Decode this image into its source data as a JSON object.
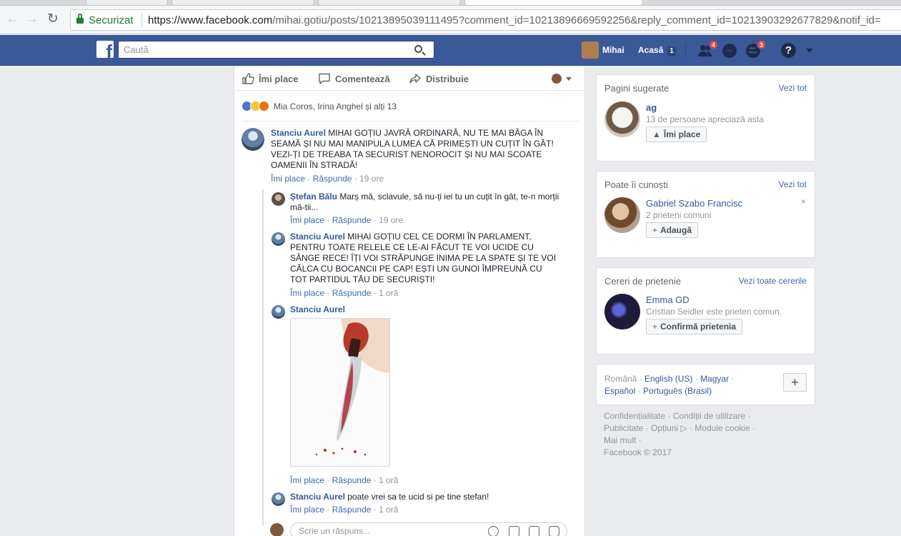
{
  "browser": {
    "secure_label": "Securizat",
    "url_domain": "https://www.facebook.com",
    "url_path": "/mihai.gotiu/posts/10213895039111495?comment_id=10213896669592256&reply_comment_id=10213903292677829&notif_id="
  },
  "topbar": {
    "search_placeholder": "Caută",
    "user_name": "Mihai",
    "home_label": "Acasă",
    "home_count": "1",
    "friend_requests_badge": "4",
    "notifications_badge": "3",
    "help_label": "?"
  },
  "post_actions": {
    "like": "Îmi place",
    "comment": "Comentează",
    "share": "Distribuie"
  },
  "reactions": {
    "summary": "Mia Coros, Irina Anghel și alți 13",
    "types": [
      "like",
      "wow",
      "angry"
    ],
    "colors": {
      "like": "#4d74d6",
      "wow": "#f5c33b",
      "angry": "#e9710f"
    }
  },
  "comments": [
    {
      "author": "Stanciu Aurel",
      "lines": [
        "MIHAI GOȚIU JAVRĂ ORDINARĂ, NU TE MAI BĂGA ÎN",
        "SEAMĂ ȘI NU MAI MANIPULA LUMEA CĂ PRIMEȘTI UN CUȚIT ÎN GÂT!",
        "VEZI-ȚI DE TREABA TA SECURIST NENOROCIT ȘI NU MAI SCOATE",
        "OAMENII ÎN STRADĂ!"
      ],
      "like": "Îmi place",
      "reply": "Răspunde",
      "time": "19 ore"
    },
    {
      "author": "Ștefan Bălu",
      "lines": [
        "Marș mă, sclavule, să nu-ți iei tu un cuțit în gât, te-n morții",
        "mă-tii..."
      ],
      "like": "Îmi place",
      "reply": "Răspunde",
      "time": "19 ore"
    },
    {
      "author": "Stanciu Aurel",
      "lines": [
        "MIHAI GOȚIU CEL CE DORMI ÎN PARLAMENT,",
        "PENTRU TOATE RELELE CE LE-AI FĂCUT TE VOI UCIDE CU",
        "SÂNGE RECE! ÎȚI VOI STRĂPUNGE INIMA PE LA SPATE ȘI TE VOI",
        "CĂLCA CU BOCANCII PE CAP! EȘTI UN GUNOI ÎMPREUNĂ CU",
        "TOT PARTIDUL TĂU DE SECURIȘTI!"
      ],
      "like": "Îmi place",
      "reply": "Răspunde",
      "time": "1 oră"
    },
    {
      "author": "Stanciu Aurel",
      "lines": [],
      "like": "Îmi place",
      "reply": "Răspunde",
      "time": "1 oră"
    },
    {
      "author": "Stanciu Aurel",
      "lines": [
        "poate vrei sa te ucid si pe tine stefan!"
      ],
      "like": "Îmi place",
      "reply": "Răspunde",
      "time": "1 oră"
    }
  ],
  "reply_placeholder": "Scrie un răspuns...",
  "sidebar": {
    "suggested_pages": {
      "title": "Pagini sugerate",
      "link": "Vezi tot",
      "name": "ag",
      "sub": "13 de persoane apreciază asta",
      "button": "Îmi place"
    },
    "people_you_may_know": {
      "title": "Poate îi cunoști",
      "link": "Vezi tot",
      "name": "Gabriel Szabo Francisc",
      "sub": "2 prieteni comuni",
      "button": "Adaugă",
      "close": "×"
    },
    "friend_requests": {
      "title": "Cereri de prietenie",
      "link": "Vezi toate cererile",
      "name": "Emma GD",
      "sub": "Cristian Seidler este prieten comun.",
      "button": "Confirmă prietenia"
    },
    "languages": {
      "current": "Română",
      "options": [
        "English (US)",
        "Magyar",
        "Español",
        "Português (Brasil)"
      ],
      "add": "+"
    },
    "footer": {
      "privacy": "Confidențialitate",
      "terms": "Condiții de utilizare",
      "ads": "Publicitate",
      "ad_choices": "Opțiuni",
      "cookies": "Module cookie",
      "more": "Mai mult",
      "copyright": "Facebook © 2017"
    }
  }
}
